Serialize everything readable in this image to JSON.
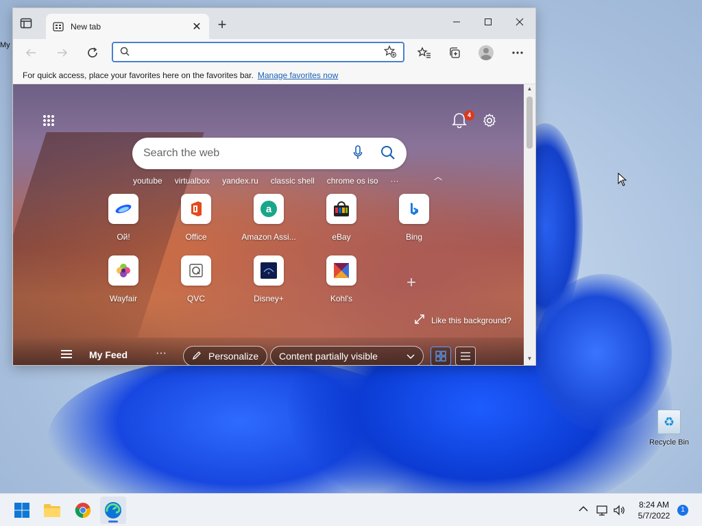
{
  "desktop": {
    "partial_icon_label": "My",
    "recycle_bin_label": "Recycle Bin"
  },
  "browser": {
    "tab_title": "New tab",
    "address_placeholder": "",
    "favorites_bar": {
      "message": "For quick access, place your favorites here on the favorites bar.",
      "link": "Manage favorites now"
    }
  },
  "ntp": {
    "notification_count": "4",
    "search_placeholder": "Search the web",
    "quick_links": [
      "youtube",
      "virtualbox",
      "yandex.ru",
      "classic shell",
      "chrome os iso",
      "···"
    ],
    "tiles": [
      {
        "label": "Ой!",
        "icon": "oi-icon"
      },
      {
        "label": "Office",
        "icon": "office-icon"
      },
      {
        "label": "Amazon Assi...",
        "icon": "amazon-assistant-icon"
      },
      {
        "label": "eBay",
        "icon": "ebay-icon"
      },
      {
        "label": "Bing",
        "icon": "bing-icon"
      },
      {
        "label": "Wayfair",
        "icon": "wayfair-icon"
      },
      {
        "label": "QVC",
        "icon": "qvc-icon"
      },
      {
        "label": "Disney+",
        "icon": "disney-plus-icon"
      },
      {
        "label": "Kohl's",
        "icon": "kohls-icon"
      }
    ],
    "like_background": "Like this background?",
    "feed": {
      "title": "My Feed",
      "more": "···",
      "personalize": "Personalize",
      "content_visibility": "Content partially visible"
    }
  },
  "taskbar": {
    "time": "8:24 AM",
    "date": "5/7/2022",
    "notification_count": "1"
  },
  "colors": {
    "accent": "#1a5fb4",
    "edge_blue": "#3a72d8",
    "badge_red": "#d93a1f"
  }
}
